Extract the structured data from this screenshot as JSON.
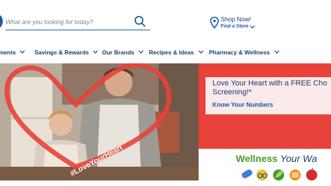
{
  "search": {
    "placeholder": "What are you looking for today?"
  },
  "icons": {
    "search": "search-icon",
    "location": "map-pin-icon",
    "chevron": "chevron-down-icon"
  },
  "store": {
    "title": "Shop Now!",
    "subtitle": "Find a Store"
  },
  "nav": {
    "items": [
      {
        "label": "ments"
      },
      {
        "label": "Savings & Rewards"
      },
      {
        "label": "Our Brands"
      },
      {
        "label": "Recipes & Ideas"
      },
      {
        "label": "Pharmacy & Wellness"
      }
    ]
  },
  "hero": {
    "hashtag": "#LoveYourHeart"
  },
  "promo": {
    "headline": "Love Your Heart with a FREE Cho Screening!*",
    "link": "Know Your Numbers"
  },
  "wellness": {
    "word1": "Wellness",
    "word2": "Your Wa"
  },
  "colors": {
    "brand_blue": "#1f5aa6",
    "navy_text": "#1b3d6b",
    "promo_red": "#e8423a",
    "wellness_green": "#4a9a2a"
  }
}
